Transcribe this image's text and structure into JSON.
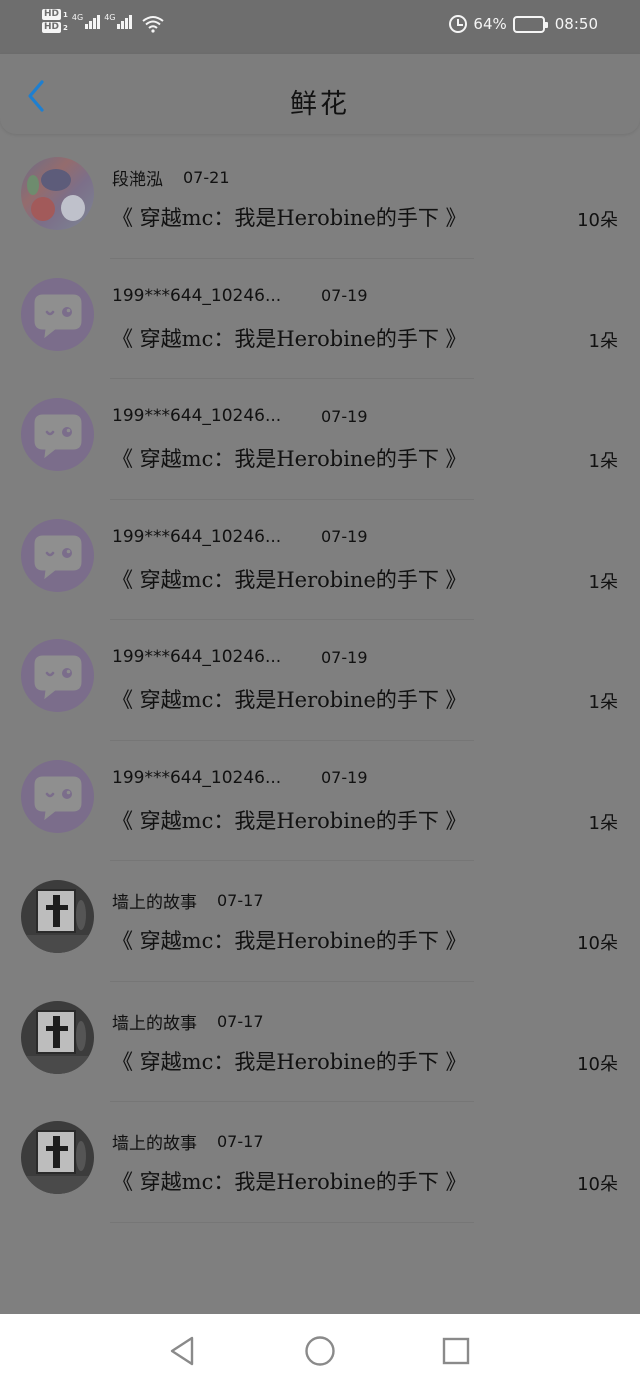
{
  "status_bar": {
    "hd1": "HD",
    "hd1_sub": "1",
    "hd2": "HD",
    "hd2_sub": "2",
    "signal1": "4G",
    "signal2": "4G",
    "battery_percent": "64%",
    "battery_level": 0.64,
    "time": "08:50"
  },
  "header": {
    "title": "鲜花"
  },
  "items": [
    {
      "name": "段滟泓",
      "date": "07-21",
      "book": "《 穿越mc：我是Herobine的手下 》",
      "count": "10朵",
      "avatar": "anime"
    },
    {
      "name": "199***644_10246...",
      "date": "07-19",
      "book": "《 穿越mc：我是Herobine的手下 》",
      "count": "1朵",
      "avatar": "default"
    },
    {
      "name": "199***644_10246...",
      "date": "07-19",
      "book": "《 穿越mc：我是Herobine的手下 》",
      "count": "1朵",
      "avatar": "default"
    },
    {
      "name": "199***644_10246...",
      "date": "07-19",
      "book": "《 穿越mc：我是Herobine的手下 》",
      "count": "1朵",
      "avatar": "default"
    },
    {
      "name": "199***644_10246...",
      "date": "07-19",
      "book": "《 穿越mc：我是Herobine的手下 》",
      "count": "1朵",
      "avatar": "default"
    },
    {
      "name": "199***644_10246...",
      "date": "07-19",
      "book": "《 穿越mc：我是Herobine的手下 》",
      "count": "1朵",
      "avatar": "default"
    },
    {
      "name": "墙上的故事",
      "date": "07-17",
      "book": "《 穿越mc：我是Herobine的手下 》",
      "count": "10朵",
      "avatar": "art"
    },
    {
      "name": "墙上的故事",
      "date": "07-17",
      "book": "《 穿越mc：我是Herobine的手下 》",
      "count": "10朵",
      "avatar": "art"
    },
    {
      "name": "墙上的故事",
      "date": "07-17",
      "book": "《 穿越mc：我是Herobine的手下 》",
      "count": "10朵",
      "avatar": "art"
    }
  ],
  "colors": {
    "accent": "#1e7fd0",
    "overlay": "#7f7f7f",
    "default_avatar": "#7b6d8b"
  }
}
